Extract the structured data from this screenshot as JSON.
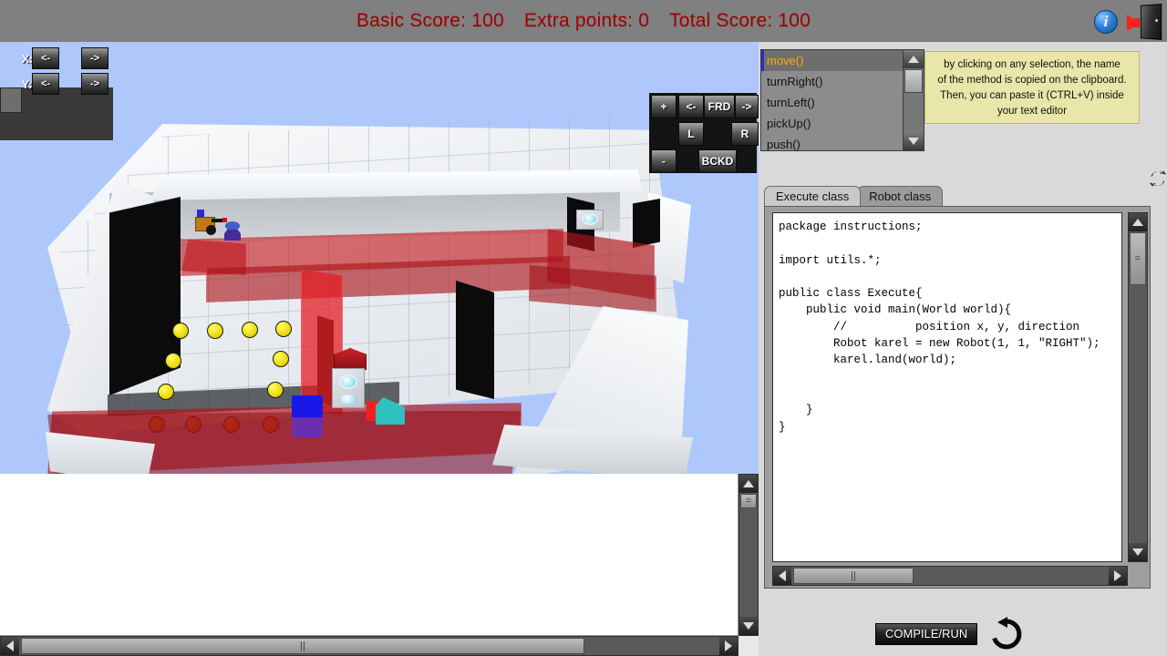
{
  "topbar": {
    "basic_score_label": "Basic Score: 100",
    "extra_points_label": "Extra points: 0",
    "total_score_label": "Total Score: 100",
    "text_color": "#a00000",
    "background": "#808080",
    "info_icon_glyph": "i",
    "info_icon_name": "info-icon",
    "exit_icon_name": "exit-door-icon"
  },
  "xy_pad": {
    "x_label": "X:",
    "y_label": "Y:",
    "x_dec": "<-",
    "x_inc": "->",
    "y_dec": "<-",
    "y_inc": "->"
  },
  "camera_pad": {
    "zoom_in": "+",
    "zoom_out": "-",
    "left_arrow": "<-",
    "right_arrow": "->",
    "forward": "FRD",
    "backward": "BCKD",
    "rotate_left": "L",
    "rotate_right": "R"
  },
  "methods": {
    "items": [
      {
        "label": "move()",
        "selected": true
      },
      {
        "label": "turnRight()",
        "selected": false
      },
      {
        "label": "turnLeft()",
        "selected": false
      },
      {
        "label": "pickUp()",
        "selected": false
      },
      {
        "label": "push()",
        "selected": false
      }
    ],
    "selected_color": "#ffb000"
  },
  "tooltip": {
    "line1": "by clicking on any selection, the name",
    "line2": "of the method is copied on the clipboard.",
    "line3": "Then, you can paste it (CTRL+V) inside",
    "line4": "your text editor",
    "background": "#e8e6a8"
  },
  "tabs": [
    {
      "label": "Execute class",
      "active": true
    },
    {
      "label": "Robot class",
      "active": false
    }
  ],
  "editor": {
    "code": "package instructions;\n\nimport utils.*;\n\npublic class Execute{\n    public void main(World world){\n        //          position x, y, direction\n        Robot karel = new Robot(1, 1, \"RIGHT\");\n        karel.land(world);\n\n\n    }\n}"
  },
  "bottom": {
    "compile_label": "COMPILE/RUN",
    "reload_icon_name": "reload-icon"
  },
  "scrollbars": {
    "thumb_grip_vertical": "=",
    "thumb_grip_horizontal": "||"
  },
  "scene": {
    "sky_color": "#aec8fc",
    "floor_color": "#f2f4f6",
    "wall_color": "#c8181e",
    "beepers_yellow": 9,
    "beepers_orange": 4,
    "robot_name": "karel-robot"
  }
}
